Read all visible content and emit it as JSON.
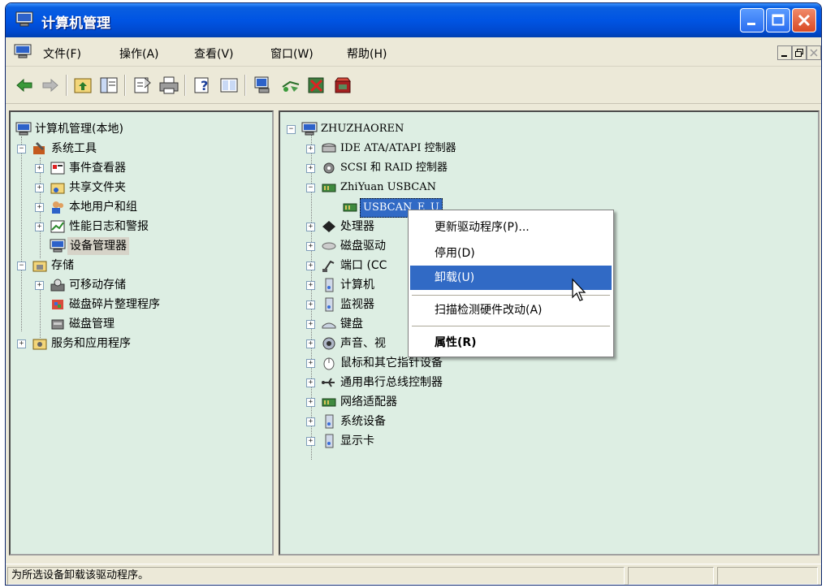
{
  "window": {
    "title": "计算机管理"
  },
  "menubar": {
    "items": [
      {
        "label": "文件(F)"
      },
      {
        "label": "操作(A)"
      },
      {
        "label": "查看(V)"
      },
      {
        "label": "窗口(W)"
      },
      {
        "label": "帮助(H)"
      }
    ]
  },
  "left_tree": {
    "root": "计算机管理(本地)",
    "system_tools": "系统工具",
    "event_viewer": "事件查看器",
    "shared_folders": "共享文件夹",
    "local_users": "本地用户和组",
    "perf_logs": "性能日志和警报",
    "device_manager": "设备管理器",
    "storage": "存储",
    "removable_storage": "可移动存储",
    "defrag": "磁盘碎片整理程序",
    "disk_mgmt": "磁盘管理",
    "services_apps": "服务和应用程序"
  },
  "right_tree": {
    "computer": "ZHUZHAOREN",
    "ide": "IDE ATA/ATAPI 控制器",
    "scsi": "SCSI 和 RAID 控制器",
    "zhiyuan": "ZhiYuan USBCAN",
    "usbcan": "USBCAN_E_U",
    "processor": "处理器",
    "disk": "磁盘驱动",
    "ports": "端口 (CC",
    "computer_node": "计算机",
    "monitor": "监视器",
    "keyboard": "键盘",
    "sound": "声音、视",
    "mouse": "鼠标和其它指针设备",
    "usb": "通用串行总线控制器",
    "network": "网络适配器",
    "system_dev": "系统设备",
    "display": "显示卡"
  },
  "context_menu": {
    "update": "更新驱动程序(P)...",
    "disable": "停用(D)",
    "uninstall": "卸载(U)",
    "scan": "扫描检测硬件改动(A)",
    "properties": "属性(R)"
  },
  "status": {
    "text": "为所选设备卸载该驱动程序。"
  },
  "colors": {
    "titlebar": "#0054e3",
    "pane_bg": "#ddeee3",
    "selection": "#316ac5",
    "chrome": "#ece9d8"
  },
  "icons": {
    "toolbar": [
      "back-icon",
      "forward-icon",
      "up-folder-icon",
      "show-tree-icon",
      "properties-icon",
      "print-icon",
      "help-icon",
      "console-tree-icon",
      "computer-icon",
      "scan-hardware-icon",
      "disable-device-icon",
      "uninstall-device-icon"
    ]
  }
}
